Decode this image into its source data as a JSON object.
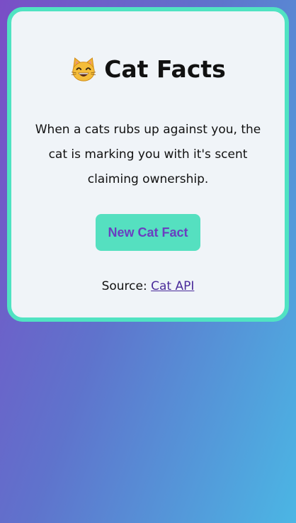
{
  "card": {
    "icon": "grinning-cat-emoji-icon",
    "title": "Cat Facts",
    "fact": "When a cats rubs up against you, the cat is marking you with it's scent claiming ownership.",
    "button_label": "New Cat Fact",
    "source_prefix": "Source:",
    "source_link": "Cat API"
  },
  "colors": {
    "card_border": "#50e3c2",
    "button_bg": "#55e0c0",
    "button_text": "#6a3fc0",
    "link": "#4a2b9a"
  }
}
